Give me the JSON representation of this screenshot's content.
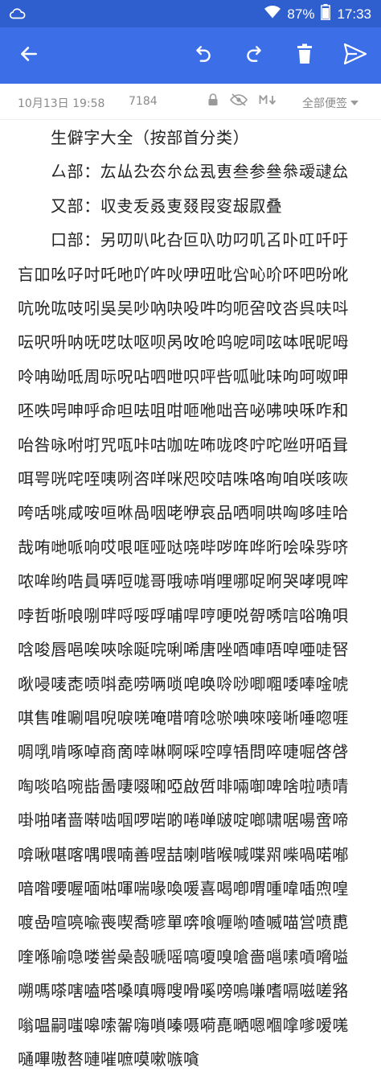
{
  "status": {
    "battery_percent": "87%",
    "time": "17:33"
  },
  "note_meta": {
    "date": "10月13日 19:58",
    "char_count": "7184",
    "category": "全部便签"
  },
  "content": {
    "title": "生僻字大全（按部首分类）",
    "line1": "厶部：厷厸厹厺厼厽厾叀叁参叄叅叆叇厽",
    "line2": "又部：収叏叐叒叓叕叚叜叝叞叠",
    "line3": "口部：另叨叭叱叴叵叺叻叼叽叾卟叿吀吁",
    "body": "吂吅吆吇吋吒吔吖吘吙吚吜吡吢吣吤吥吧吩吪吭吮吰吱吲吳吴吵吶吷吺吽呁呃呄呅呇呉呋呌呍呎呏呐呒呓呔呕呗呙呚呛呜呝呞呟呠呡呢呣呤呥呦呧周呩呪呫呬呭呮呯呰呱呲味呴呵呶呷呸呹呺呻呼命呾呿咀咁咂咃咄咅咇咈咉咊咋和咍咎咏咐咑咒咓咔咕咖咗咘咙咚咛咜咝咞咟咠咡咢咣咤咥咦咧咨咩咪咫咬咭咮咯咰咱咲咳咴咵咶咷咸咹咺咻咼咽咾咿哀品哂哃哄哅哆哇哈哉哊哋哌响哎哏哐哑哒哓哔哕哖哗哘哙哚哛哜哝哞哟哠員哢哣哤哥哦哧哨哩哪哫哬哭哮哯哰哱哲哳哴哵哶哷哸哹哺哻哼哽哾哿唀唁唂唃唄唅唆唇唈唉唊唋唌唍唎唏唐唑唒唓唔唕唖唗唘唙唚唛唜唝唞唟唠唡唢唣唤唥唦唧唨唩唪唫唬唭售唯唰唱唲唳唴唵唶唷唸唹唺唻唼唽唾唿啀啁啂啃啄啅商啇啈啉啊啋啌啍啎問啐啑啒啓啔啕啖啗啘啙啚啛啜啝啞啟啠啡啢啣啤啥啦啧啨啩啪啫啬啭啮啯啰啱啲啳啴啵啶啷啸啹啺啻啼啽啾啿喀喁喂喃善喅喆喇喈喉喊喋喌喍喎喏喐喑喒喓喔喕喖喗喘喙喚喛喜喝喞喟喠喡喢喣喤喥喦喧喨喩喪喫喬喭單喯喰喱喲喳喴喵営喷喸喹喺喻喼喽喾喿嗀嗁嗂嗃嗄嗅嗆嗇嗈嗉嗊嗋嗌嗍嗎嗏嗐嗑嗒嗓嗔嗕嗖嗗嗘嗙嗚嗛嗜嗝嗞嗟嗠嗡嗢嗣嗤嗥嗦嗧嗨嗩嗪嗫嗬嗭嗮嗯嗰嗱嗲嗳嗴嗵嗶嗷嗸嗹嗺嗻嗼嗽嗾嗿"
  },
  "colors": {
    "statusbar": "#2f5fcf",
    "toolbar": "#3c6ee8",
    "meta_text": "#8a8a8a",
    "body_text": "#222222"
  },
  "icons": {
    "toolbar": [
      "back-arrow-icon",
      "undo-icon",
      "redo-icon",
      "trash-icon",
      "send-icon"
    ],
    "meta": [
      "lock-icon",
      "eye-off-icon",
      "markdown-icon",
      "dropdown-icon"
    ]
  }
}
